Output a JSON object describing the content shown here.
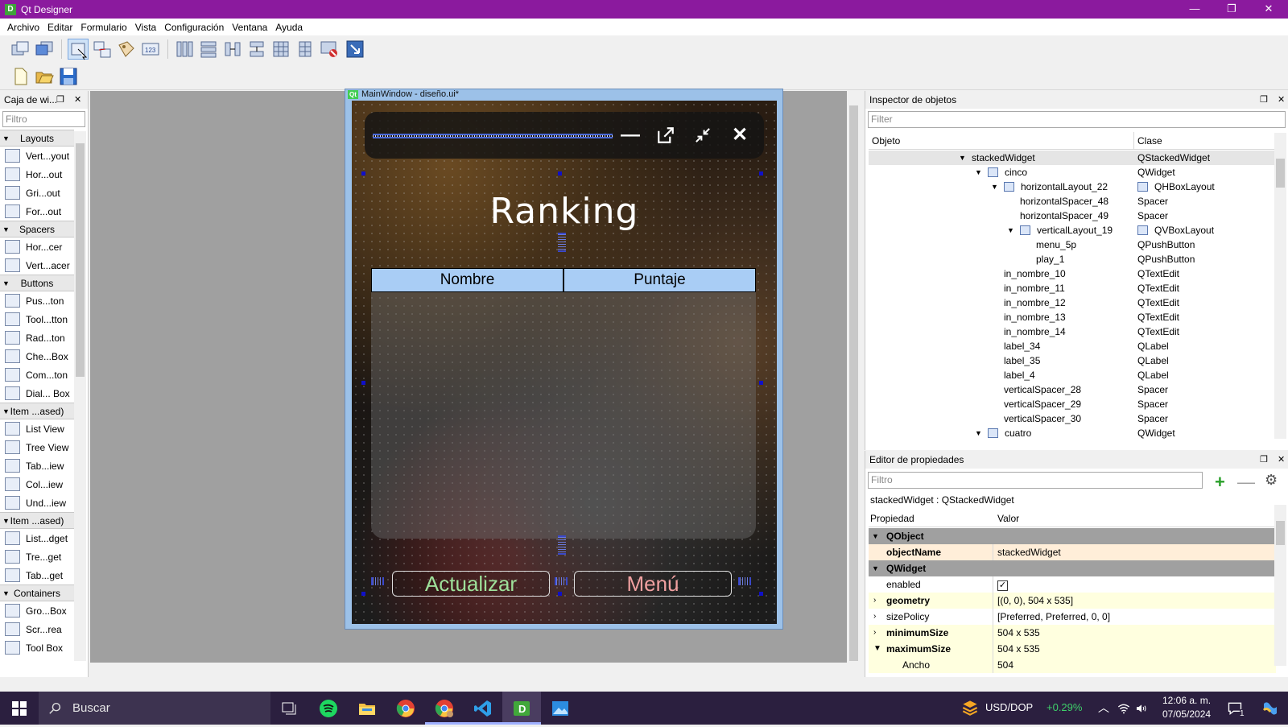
{
  "window": {
    "title": "Qt Designer",
    "app_icon": "D",
    "minimize": "—",
    "restore": "❐",
    "close": "✕"
  },
  "menu": [
    "Archivo",
    "Editar",
    "Formulario",
    "Vista",
    "Configuración",
    "Ventana",
    "Ayuda"
  ],
  "widget_box": {
    "title": "Caja de wi...",
    "filter_placeholder": "Filtro",
    "categories": [
      {
        "label": "Layouts",
        "items": [
          "Vert...yout",
          "Hor...out",
          "Gri...out",
          "For...out"
        ]
      },
      {
        "label": "Spacers",
        "items": [
          "Hor...cer",
          "Vert...acer"
        ]
      },
      {
        "label": "Buttons",
        "items": [
          "Pus...ton",
          "Tool...tton",
          "Rad...ton",
          "Che...Box",
          "Com...ton",
          "Dial... Box"
        ]
      },
      {
        "label": "Item ...ased)",
        "items": [
          "List View",
          "Tree View",
          "Tab...iew",
          "Col...iew",
          "Und...iew"
        ]
      },
      {
        "label": "Item ...ased)",
        "items": [
          "List...dget",
          "Tre...get",
          "Tab...get"
        ]
      },
      {
        "label": "Containers",
        "items": [
          "Gro...Box",
          "Scr...rea",
          "Tool Box"
        ]
      }
    ]
  },
  "form": {
    "title": "MainWindow - diseño.ui*",
    "heading": "Ranking",
    "table_headers": [
      "Nombre",
      "Puntaje"
    ],
    "btn_update": "Actualizar",
    "btn_menu": "Menú",
    "colors": {
      "update_text": "#9ee09a",
      "menu_text": "#f0a0a0",
      "header_bg": "#a9cdf5"
    }
  },
  "inspector": {
    "title": "Inspector de objetos",
    "filter_placeholder": "Filter",
    "col_object": "Objeto",
    "col_class": "Clase",
    "rows": [
      {
        "name": "stackedWidget",
        "cls": "QStackedWidget",
        "depth": 0,
        "expanded": true
      },
      {
        "name": "cinco",
        "cls": "QWidget",
        "depth": 1,
        "expanded": true,
        "icon": true
      },
      {
        "name": "horizontalLayout_22",
        "cls": "QHBoxLayout",
        "depth": 2,
        "expanded": true,
        "icon": true,
        "cls_icon": true
      },
      {
        "name": "horizontalSpacer_48",
        "cls": "Spacer",
        "depth": 3
      },
      {
        "name": "horizontalSpacer_49",
        "cls": "Spacer",
        "depth": 3
      },
      {
        "name": "verticalLayout_19",
        "cls": "QVBoxLayout",
        "depth": 3,
        "expanded": true,
        "icon": true,
        "cls_icon": true
      },
      {
        "name": "menu_5p",
        "cls": "QPushButton",
        "depth": 4
      },
      {
        "name": "play_1",
        "cls": "QPushButton",
        "depth": 4
      },
      {
        "name": "in_nombre_10",
        "cls": "QTextEdit",
        "depth": 2
      },
      {
        "name": "in_nombre_11",
        "cls": "QTextEdit",
        "depth": 2
      },
      {
        "name": "in_nombre_12",
        "cls": "QTextEdit",
        "depth": 2
      },
      {
        "name": "in_nombre_13",
        "cls": "QTextEdit",
        "depth": 2
      },
      {
        "name": "in_nombre_14",
        "cls": "QTextEdit",
        "depth": 2
      },
      {
        "name": "label_34",
        "cls": "QLabel",
        "depth": 2
      },
      {
        "name": "label_35",
        "cls": "QLabel",
        "depth": 2
      },
      {
        "name": "label_4",
        "cls": "QLabel",
        "depth": 2
      },
      {
        "name": "verticalSpacer_28",
        "cls": "Spacer",
        "depth": 2
      },
      {
        "name": "verticalSpacer_29",
        "cls": "Spacer",
        "depth": 2
      },
      {
        "name": "verticalSpacer_30",
        "cls": "Spacer",
        "depth": 2
      },
      {
        "name": "cuatro",
        "cls": "QWidget",
        "depth": 1,
        "expanded": true,
        "icon": true
      }
    ]
  },
  "property_editor": {
    "title": "Editor de propiedades",
    "filter_placeholder": "Filtro",
    "context": "stackedWidget : QStackedWidget",
    "col_prop": "Propiedad",
    "col_value": "Valor",
    "rows": [
      {
        "type": "section",
        "name": "QObject"
      },
      {
        "type": "prop",
        "name": "objectName",
        "value": "stackedWidget",
        "bold": true,
        "bg": "orange"
      },
      {
        "type": "section",
        "name": "QWidget"
      },
      {
        "type": "check",
        "name": "enabled",
        "checked": true,
        "bg": "white"
      },
      {
        "type": "prop",
        "name": "geometry",
        "value": "[(0, 0), 504 x 535]",
        "bold": true,
        "bg": "yellow",
        "expander": "right"
      },
      {
        "type": "prop",
        "name": "sizePolicy",
        "value": "[Preferred, Preferred, 0, 0]",
        "bg": "white",
        "expander": "right"
      },
      {
        "type": "prop",
        "name": "minimumSize",
        "value": "504 x 535",
        "bold": true,
        "bg": "yellow",
        "expander": "right"
      },
      {
        "type": "prop",
        "name": "maximumSize",
        "value": "504 x 535",
        "bold": true,
        "bg": "yellow",
        "expander": "down"
      },
      {
        "type": "prop",
        "name": "Ancho",
        "value": "504",
        "bg": "yellow",
        "sub": true
      }
    ]
  },
  "taskbar": {
    "search_placeholder": "Buscar",
    "ticker": "USD/DOP",
    "ticker_change": "+0.29%",
    "time": "12:06 a. m.",
    "date": "07/05/2024",
    "notifications": "1"
  }
}
